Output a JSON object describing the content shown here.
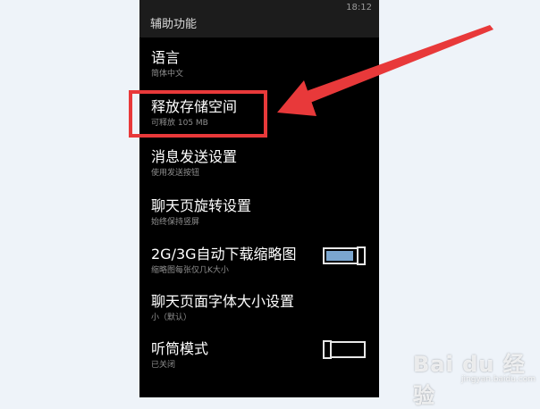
{
  "status": {
    "time": "18:12"
  },
  "header": {
    "title": "辅助功能"
  },
  "settings": [
    {
      "title": "语言",
      "subtitle": "简体中文"
    },
    {
      "title": "释放存储空间",
      "subtitle": "可释放 105 MB"
    },
    {
      "title": "消息发送设置",
      "subtitle": "使用发送按钮"
    },
    {
      "title": "聊天页旋转设置",
      "subtitle": "始终保持竖屏"
    },
    {
      "title": "2G/3G自动下载缩略图",
      "subtitle": "缩略图每张仅几K大小",
      "toggle_on": true
    },
    {
      "title": "聊天页面字体大小设置",
      "subtitle": "小（默认）"
    },
    {
      "title": "听筒模式",
      "subtitle": "已关闭",
      "toggle_on": false
    }
  ],
  "colors": {
    "annotation": "#e8393a",
    "accent": "#7ba6cf"
  },
  "watermark": {
    "text": "Bai du 经验",
    "sub": "jingyan.baidu.com"
  }
}
